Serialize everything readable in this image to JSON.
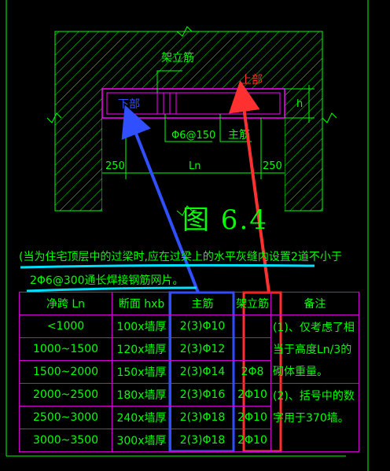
{
  "figure": {
    "title": "图 6.4",
    "labels": {
      "stirrup": "架立筋",
      "top": "上部",
      "bottom": "下部",
      "height": "h",
      "hoop": "Φ6@150",
      "main_bar": "主筋",
      "left_support": "250",
      "span": "Ln",
      "right_support": "250"
    }
  },
  "note": {
    "line1": "(当为住宅顶层中的过梁时,应在过梁上的水平灰缝内设置2道不小于",
    "line2": "2Φ6@300通长焊接钢筋网片。"
  },
  "table": {
    "headers": [
      "净跨 Ln",
      "断面 hxb",
      "主筋",
      "架立筋",
      "备注"
    ],
    "rows": [
      [
        "<1000",
        "100x墙厚",
        "2(3)Φ10",
        ""
      ],
      [
        "1000~1500",
        "120x墙厚",
        "2(3)Φ12",
        ""
      ],
      [
        "1500~2000",
        "150x墙厚",
        "2(3)Φ14",
        "2Φ8"
      ],
      [
        "2000~2500",
        "180x墙厚",
        "2(3)Φ16",
        "2Φ10"
      ],
      [
        "2500~3000",
        "240x墙厚",
        "2(3)Φ18",
        "2Φ10"
      ],
      [
        "3000~3500",
        "300x墙厚",
        "2(3)Φ18",
        "2Φ10"
      ]
    ],
    "remarks": [
      "(1)、仅考虑了相当于高度Ln/3的砌体重量。",
      "(2)、括号中的数字用于370墙。"
    ]
  },
  "colors": {
    "background": "#000000",
    "lines": "#00ff00",
    "beam": "#ff00ff",
    "top_arrow": "#ff3030",
    "bottom_arrow": "#3050ff",
    "highlight": "#00e0ff"
  }
}
